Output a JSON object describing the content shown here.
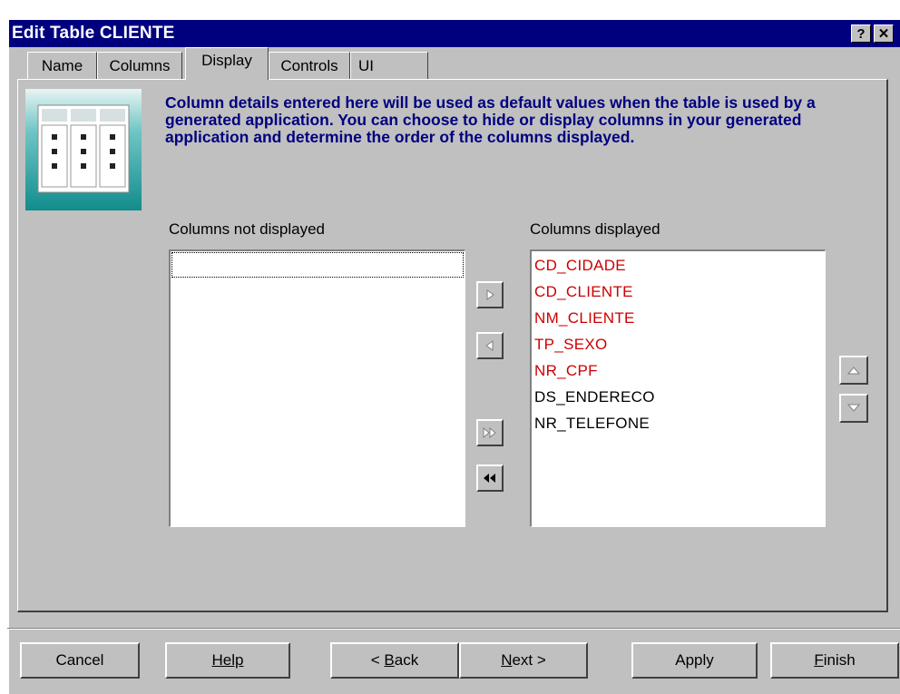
{
  "window": {
    "title": "Edit Table CLIENTE",
    "help_label": "?",
    "close_label": "✕"
  },
  "tabs": [
    {
      "label": "Name"
    },
    {
      "label": "Columns"
    },
    {
      "label": "Display",
      "active": true
    },
    {
      "label": "Controls"
    },
    {
      "label": "UI"
    }
  ],
  "description": "Column details entered here will be used as default values when the table is used by a generated application. You can choose to hide or display columns in your generated application and determine the order of the columns displayed.",
  "not_displayed": {
    "label": "Columns not displayed",
    "items": []
  },
  "displayed": {
    "label": "Columns displayed",
    "items": [
      {
        "text": "CD_CIDADE",
        "color": "#cc0000"
      },
      {
        "text": "CD_CLIENTE",
        "color": "#cc0000"
      },
      {
        "text": "NM_CLIENTE",
        "color": "#cc0000"
      },
      {
        "text": "TP_SEXO",
        "color": "#cc0000"
      },
      {
        "text": "NR_CPF",
        "color": "#cc0000"
      },
      {
        "text": "DS_ENDERECO",
        "color": "#000000"
      },
      {
        "text": "NR_TELEFONE",
        "color": "#000000"
      }
    ]
  },
  "buttons": {
    "cancel": "Cancel",
    "help": "Help",
    "back": "< Back",
    "next": "Next >",
    "apply": "Apply",
    "finish": "Finish"
  },
  "icons": {
    "move_right": "move-right-icon",
    "move_left": "move-left-icon",
    "move_all_right": "move-all-right-icon",
    "move_all_left": "move-all-left-icon",
    "move_up": "move-up-icon",
    "move_down": "move-down-icon"
  },
  "colors": {
    "titlebar": "#00007f",
    "description": "#000080",
    "required_column": "#cc0000"
  }
}
